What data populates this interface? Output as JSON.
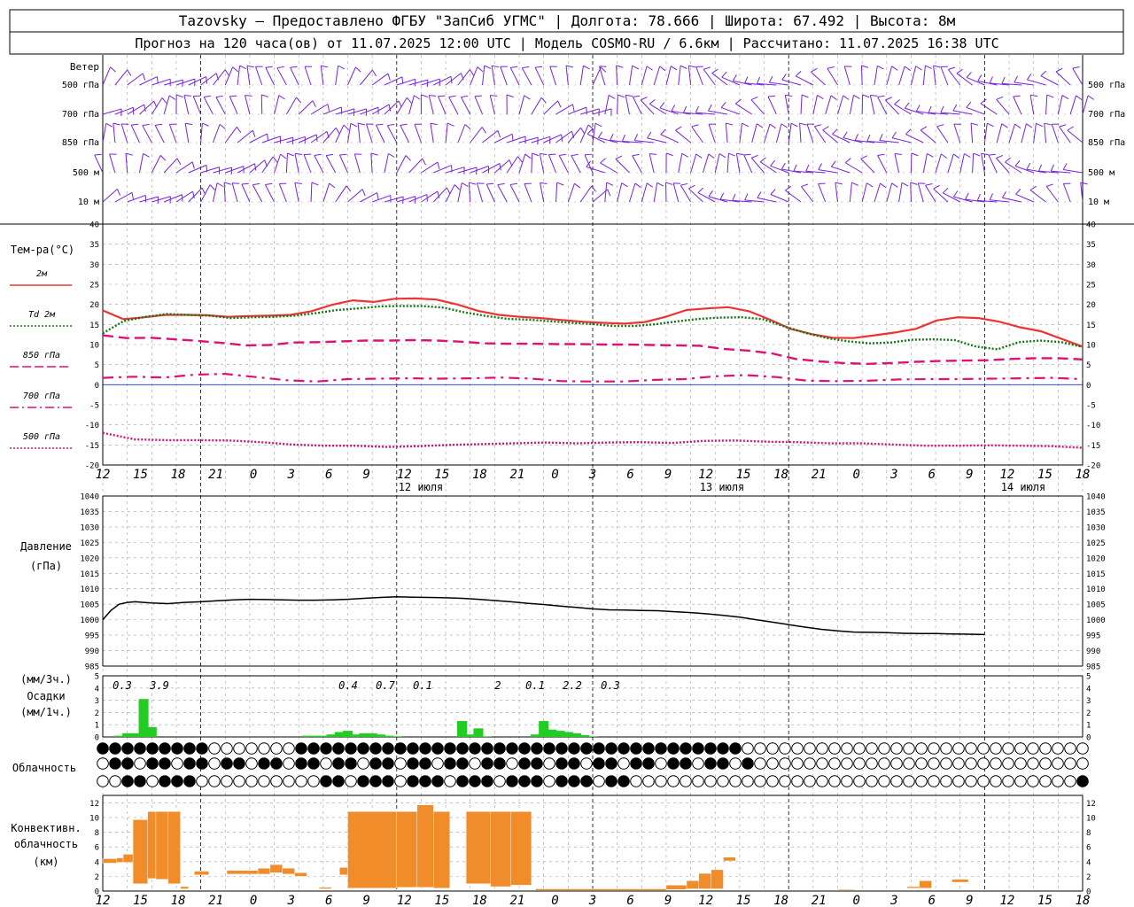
{
  "header": {
    "line1": "Tazovsky — Предоставлено ФГБУ \"ЗапСиб УГМС\" | Долгота: 78.666 | Широта: 67.492 | Высота: 8м",
    "line2": "Прогноз на 120 часа(ов) от 11.07.2025 12:00 UTC  | Модель COSMO-RU / 6.6км | Рассчитано: 11.07.2025 16:38 UTC"
  },
  "wind_panel": {
    "title": "Ветер",
    "levels": [
      "500 гПа",
      "700 гПа",
      "850 гПа",
      "500 м",
      "10  м"
    ]
  },
  "temp_panel": {
    "title": "Тем-ра(°С)",
    "legend": [
      {
        "label": "2м",
        "color": "#ee3333",
        "dash": "solid"
      },
      {
        "label": "Td  2м",
        "color": "#117711",
        "dash": "dotted"
      },
      {
        "label": "850 гПа",
        "color": "#dd1177",
        "dash": "long"
      },
      {
        "label": "700 гПа",
        "color": "#dd1177",
        "dash": "dashdot"
      },
      {
        "label": "500 гПа",
        "color": "#dd1177",
        "dash": "dot"
      }
    ],
    "yticks": [
      "40",
      "35",
      "30",
      "25",
      "20",
      "15",
      "10",
      "5",
      "0",
      "-5",
      "-10",
      "-15",
      "-20"
    ]
  },
  "x_axis": {
    "hour_labels": [
      "12",
      "15",
      "18",
      "21",
      "0",
      "3",
      "6",
      "9",
      "12",
      "15",
      "18",
      "21",
      "0",
      "3",
      "6",
      "9",
      "12",
      "15",
      "18",
      "21",
      "0",
      "3",
      "6",
      "9",
      "12",
      "15",
      "18"
    ],
    "day_labels": [
      "12 июля",
      "13 июля",
      "14 июля"
    ]
  },
  "pressure_panel": {
    "title1": "Давление",
    "title2": "(гПа)",
    "yticks": [
      "1040",
      "1035",
      "1030",
      "1025",
      "1020",
      "1015",
      "1010",
      "1005",
      "1000",
      "995",
      "990",
      "985"
    ]
  },
  "precip_panel": {
    "title1": "(мм/3ч.)",
    "title2": "Осадки",
    "title3": "(мм/1ч.)",
    "yticks": [
      "5",
      "4",
      "3",
      "2",
      "1",
      "0"
    ],
    "totals": [
      "0.3",
      "3.9",
      "0.4",
      "0.7",
      "0.1",
      "2",
      "0.1",
      "2.2",
      "0.3"
    ]
  },
  "cloud_panel": {
    "title": "Облачность"
  },
  "conv_panel": {
    "title1": "Конвективн.",
    "title2": "облачность",
    "title3": "(км)",
    "yticks": [
      "12",
      "10",
      "8",
      "6",
      "4",
      "2",
      "0"
    ]
  },
  "colors": {
    "wind": "#7722dd",
    "temp2m": "#ee3333",
    "dewpoint": "#117711",
    "upper": "#dd1177",
    "precip": "#22cc22",
    "conv": "#f08c2a",
    "grid": "#a0a0a0"
  },
  "chart_data": [
    {
      "type": "line",
      "title": "Тем-ра(°С)",
      "x_hours": [
        0,
        3,
        6,
        9,
        12,
        15,
        18,
        21,
        24,
        27,
        30,
        33,
        36,
        39,
        42,
        45,
        48,
        51,
        54,
        57,
        60,
        63,
        66,
        69,
        72,
        75,
        78,
        81,
        84,
        87,
        90,
        93,
        96,
        99,
        102,
        105,
        108,
        111,
        114,
        117,
        120
      ],
      "ylim": [
        -20,
        40
      ],
      "series": [
        {
          "name": "2м",
          "values": [
            18.5,
            16.3,
            16.8,
            17.4,
            17.4,
            17.3,
            16.9,
            17.1,
            17.2,
            17.4,
            18.3,
            19.9,
            21.0,
            20.6,
            21.4,
            21.5,
            21.2,
            20.0,
            18.4,
            17.4,
            16.9,
            16.6,
            16.1,
            15.7,
            15.4,
            15.2,
            15.6,
            16.9,
            18.6,
            19.0,
            19.3,
            18.3,
            16.2,
            13.9,
            12.6,
            11.7,
            11.6,
            12.3,
            13.0,
            13.9,
            16.0,
            16.8,
            16.6,
            15.7,
            14.3,
            13.3,
            11.4,
            9.5
          ]
        },
        {
          "name": "Td  2м",
          "values": [
            12.8,
            15.9,
            16.9,
            17.6,
            17.4,
            17.2,
            16.6,
            16.8,
            16.9,
            17.2,
            17.8,
            18.6,
            19.0,
            19.5,
            19.6,
            19.6,
            19.2,
            18.0,
            17.1,
            16.4,
            16.2,
            15.8,
            15.4,
            15.1,
            14.6,
            14.6,
            15.1,
            15.8,
            16.4,
            16.7,
            16.8,
            16.3,
            14.5,
            12.9,
            11.6,
            10.8,
            10.3,
            10.5,
            11.2,
            11.3,
            11.1,
            9.5,
            8.8,
            10.6,
            11.0,
            10.6,
            9.4
          ]
        },
        {
          "name": "850 гПа",
          "values": [
            12.3,
            11.6,
            11.7,
            11.3,
            10.9,
            10.4,
            9.8,
            9.9,
            10.5,
            10.6,
            10.8,
            11.0,
            11.0,
            11.1,
            11.0,
            10.7,
            10.3,
            10.2,
            10.2,
            10.1,
            10.1,
            10.0,
            10.0,
            9.9,
            9.8,
            9.7,
            8.9,
            8.5,
            7.8,
            6.4,
            5.8,
            5.4,
            5.2,
            5.4,
            5.7,
            5.9,
            6.0,
            6.1,
            6.4,
            6.6,
            6.6,
            6.3
          ]
        },
        {
          "name": "700 гПа",
          "values": [
            1.7,
            2.0,
            1.8,
            2.5,
            2.7,
            1.9,
            1.1,
            0.8,
            1.4,
            1.5,
            1.6,
            1.5,
            1.6,
            1.8,
            1.5,
            0.9,
            0.8,
            0.8,
            1.2,
            1.4,
            2.1,
            2.4,
            1.9,
            1.0,
            0.9,
            1.0,
            1.3,
            1.4,
            1.4,
            1.5,
            1.6,
            1.7,
            1.4
          ]
        },
        {
          "name": "500 гПа",
          "values": [
            -12.0,
            -13.6,
            -13.8,
            -13.8,
            -13.9,
            -14.3,
            -14.9,
            -15.2,
            -15.2,
            -15.5,
            -15.3,
            -15.0,
            -14.8,
            -14.6,
            -14.4,
            -14.6,
            -14.4,
            -14.3,
            -14.5,
            -14.0,
            -13.9,
            -14.2,
            -14.3,
            -14.6,
            -14.6,
            -14.9,
            -15.2,
            -15.2,
            -15.1,
            -15.2,
            -15.3,
            -15.7
          ]
        }
      ]
    },
    {
      "type": "line",
      "title": "Давление (гПа)",
      "x_hours": [
        0,
        1,
        2,
        3,
        4,
        5,
        6,
        8,
        10,
        12,
        14,
        16,
        18,
        20,
        22,
        24,
        26,
        28,
        30,
        32,
        34,
        36,
        38,
        40,
        42,
        44,
        46,
        48,
        50,
        52,
        54,
        56,
        58,
        60,
        62,
        64,
        66,
        68,
        70,
        72,
        74,
        76,
        78,
        80,
        82,
        84,
        86,
        88,
        90,
        92,
        94,
        96,
        98,
        100,
        102,
        104,
        106,
        108,
        110,
        112,
        114,
        116,
        118,
        120
      ],
      "ylim": [
        985,
        1040
      ],
      "series": [
        {
          "name": "Давление",
          "values": [
            1000,
            1003,
            1005,
            1005.6,
            1005.8,
            1005.6,
            1005.4,
            1005.2,
            1005.6,
            1005.8,
            1006.1,
            1006.4,
            1006.6,
            1006.5,
            1006.4,
            1006.3,
            1006.3,
            1006.4,
            1006.6,
            1006.9,
            1007.2,
            1007.4,
            1007.3,
            1007.2,
            1007.1,
            1006.9,
            1006.6,
            1006.2,
            1005.8,
            1005.3,
            1004.9,
            1004.4,
            1004.0,
            1003.5,
            1003.2,
            1003.1,
            1003.0,
            1002.9,
            1002.6,
            1002.3,
            1001.9,
            1001.4,
            1000.8,
            1000.0,
            999.2,
            998.4,
            997.6,
            996.9,
            996.4,
            996.0,
            995.9,
            995.8,
            995.6,
            995.5,
            995.5,
            995.4,
            995.3,
            995.2
          ]
        }
      ]
    },
    {
      "type": "bar",
      "title": "Осадки (мм/1ч.)",
      "x_hours": [
        2,
        3,
        4,
        5,
        6,
        25,
        26,
        27,
        28,
        29,
        30,
        31,
        32,
        33,
        34,
        35,
        36,
        44,
        45,
        46,
        47,
        53,
        54,
        55,
        56,
        57,
        58,
        59,
        60
      ],
      "ylim": [
        0,
        5
      ],
      "values": [
        0.1,
        0.3,
        0.3,
        3.1,
        0.8,
        0.1,
        0.1,
        0.1,
        0.2,
        0.4,
        0.5,
        0.2,
        0.3,
        0.3,
        0.2,
        0.1,
        0.05,
        1.3,
        0.2,
        0.7,
        0.05,
        0.2,
        1.3,
        0.6,
        0.5,
        0.4,
        0.3,
        0.15,
        0.05
      ]
    },
    {
      "type": "bar",
      "title": "Конвективн. облачность (км)",
      "ylim": [
        0,
        13
      ],
      "bars": [
        {
          "x0": 0,
          "x1": 1.7,
          "bot": 3.8,
          "top": 4.4
        },
        {
          "x0": 1.7,
          "x1": 2.5,
          "bot": 3.9,
          "top": 4.5
        },
        {
          "x0": 2.5,
          "x1": 3.7,
          "bot": 3.9,
          "top": 5.0
        },
        {
          "x0": 3.7,
          "x1": 5.5,
          "bot": 1.0,
          "top": 9.7
        },
        {
          "x0": 5.5,
          "x1": 6.5,
          "bot": 1.7,
          "top": 10.8
        },
        {
          "x0": 6.5,
          "x1": 8.0,
          "bot": 1.6,
          "top": 10.8
        },
        {
          "x0": 8.0,
          "x1": 9.5,
          "bot": 1.0,
          "top": 10.8
        },
        {
          "x0": 9.5,
          "x1": 10.5,
          "bot": 0.3,
          "top": 0.6
        },
        {
          "x0": 11.2,
          "x1": 13.0,
          "bot": 2.2,
          "top": 2.7
        },
        {
          "x0": 15.2,
          "x1": 19.0,
          "bot": 2.3,
          "top": 2.8
        },
        {
          "x0": 19.0,
          "x1": 20.5,
          "bot": 2.3,
          "top": 3.1
        },
        {
          "x0": 20.5,
          "x1": 22.0,
          "bot": 2.5,
          "top": 3.6
        },
        {
          "x0": 22.0,
          "x1": 23.5,
          "bot": 2.3,
          "top": 3.1
        },
        {
          "x0": 23.5,
          "x1": 25.0,
          "bot": 2.0,
          "top": 2.5
        },
        {
          "x0": 26.5,
          "x1": 28.0,
          "bot": 0.3,
          "top": 0.5
        },
        {
          "x0": 29.0,
          "x1": 30.0,
          "bot": 2.2,
          "top": 3.2
        },
        {
          "x0": 30.0,
          "x1": 36.0,
          "bot": 0.4,
          "top": 10.8
        },
        {
          "x0": 36.0,
          "x1": 38.5,
          "bot": 0.5,
          "top": 10.8
        },
        {
          "x0": 38.5,
          "x1": 40.5,
          "bot": 0.5,
          "top": 11.7
        },
        {
          "x0": 40.5,
          "x1": 42.5,
          "bot": 0.4,
          "top": 10.8
        },
        {
          "x0": 44.5,
          "x1": 47.5,
          "bot": 1.0,
          "top": 10.8
        },
        {
          "x0": 47.5,
          "x1": 50.0,
          "bot": 0.6,
          "top": 10.8
        },
        {
          "x0": 50.0,
          "x1": 52.5,
          "bot": 0.8,
          "top": 10.8
        },
        {
          "x0": 53.0,
          "x1": 69.0,
          "bot": 0.1,
          "top": 0.3
        },
        {
          "x0": 69.0,
          "x1": 71.5,
          "bot": 0.2,
          "top": 0.8
        },
        {
          "x0": 71.5,
          "x1": 73.0,
          "bot": 0.3,
          "top": 1.4
        },
        {
          "x0": 73.0,
          "x1": 74.5,
          "bot": 0.3,
          "top": 2.4
        },
        {
          "x0": 74.5,
          "x1": 76.0,
          "bot": 0.3,
          "top": 2.9
        },
        {
          "x0": 76.0,
          "x1": 77.5,
          "bot": 4.1,
          "top": 4.6
        },
        {
          "x0": 90.0,
          "x1": 92.0,
          "bot": 0.1,
          "top": 0.2
        },
        {
          "x0": 98.5,
          "x1": 100.0,
          "bot": 0.4,
          "top": 0.6
        },
        {
          "x0": 100.0,
          "x1": 101.5,
          "bot": 0.4,
          "top": 1.4
        },
        {
          "x0": 104.0,
          "x1": 106.0,
          "bot": 1.2,
          "top": 1.6
        }
      ]
    }
  ]
}
